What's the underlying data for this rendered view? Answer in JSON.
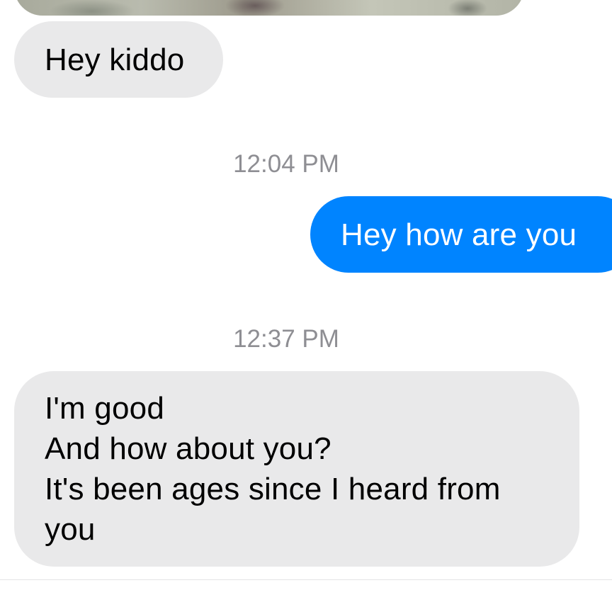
{
  "conversation": {
    "messages": [
      {
        "type": "received",
        "lines": [
          "Hey kiddo"
        ]
      },
      {
        "type": "timestamp",
        "text": "12:04 PM"
      },
      {
        "type": "sent",
        "lines": [
          "Hey how are you"
        ]
      },
      {
        "type": "timestamp",
        "text": "12:37 PM"
      },
      {
        "type": "received",
        "lines": [
          "I'm good",
          "And how about you?",
          "It's been ages since I heard from",
          "you"
        ]
      }
    ]
  },
  "colors": {
    "sent_bubble": "#0084ff",
    "received_bubble": "#e9e9ea",
    "timestamp_text": "#8e8e93"
  }
}
